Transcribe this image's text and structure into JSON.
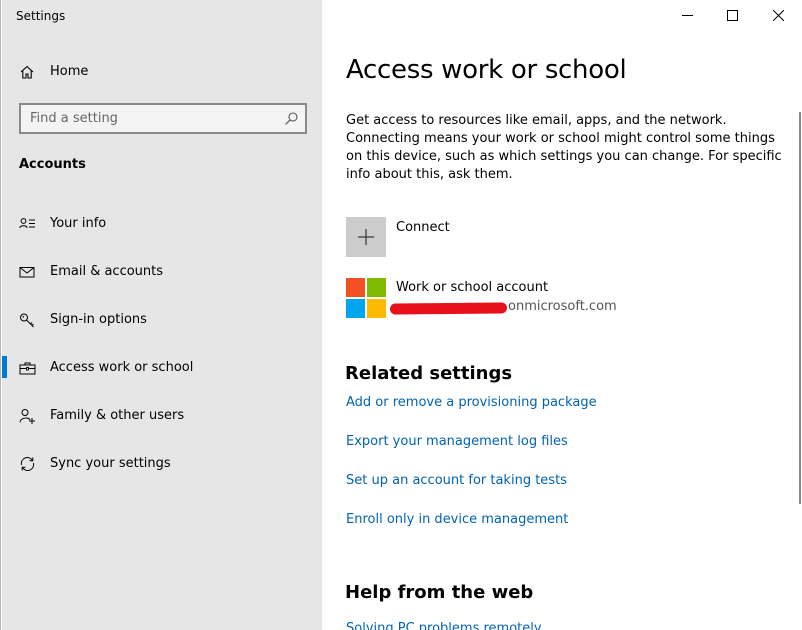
{
  "window": {
    "title": "Settings",
    "controls": {
      "minimize": "minimize",
      "maximize": "maximize",
      "close": "close"
    }
  },
  "sidebar": {
    "home_label": "Home",
    "search_placeholder": "Find a setting",
    "section_label": "Accounts",
    "items": [
      {
        "label": "Your info",
        "icon": "person-card-icon",
        "active": false
      },
      {
        "label": "Email & accounts",
        "icon": "mail-icon",
        "active": false
      },
      {
        "label": "Sign-in options",
        "icon": "key-icon",
        "active": false
      },
      {
        "label": "Access work or school",
        "icon": "briefcase-icon",
        "active": true
      },
      {
        "label": "Family & other users",
        "icon": "person-add-icon",
        "active": false
      },
      {
        "label": "Sync your settings",
        "icon": "sync-icon",
        "active": false
      }
    ]
  },
  "main": {
    "title": "Access work or school",
    "description": "Get access to resources like email, apps, and the network. Connecting means your work or school might control some things on this device, such as which settings you can change. For specific info about this, ask them.",
    "connect_label": "Connect",
    "account": {
      "title": "Work or school account",
      "email_suffix": "onmicrosoft.com"
    },
    "related_title": "Related settings",
    "related_links": [
      "Add or remove a provisioning package",
      "Export your management log files",
      "Set up an account for taking tests",
      "Enroll only in device management"
    ],
    "help_title": "Help from the web",
    "help_links": [
      "Solving PC problems remotely"
    ]
  },
  "colors": {
    "accent": "#0078d7",
    "link": "#0063b1",
    "sidebar_bg": "#e6e6e6",
    "ms_red": "#f25022",
    "ms_green": "#7fba00",
    "ms_blue": "#00a4ef",
    "ms_yellow": "#ffb900"
  }
}
